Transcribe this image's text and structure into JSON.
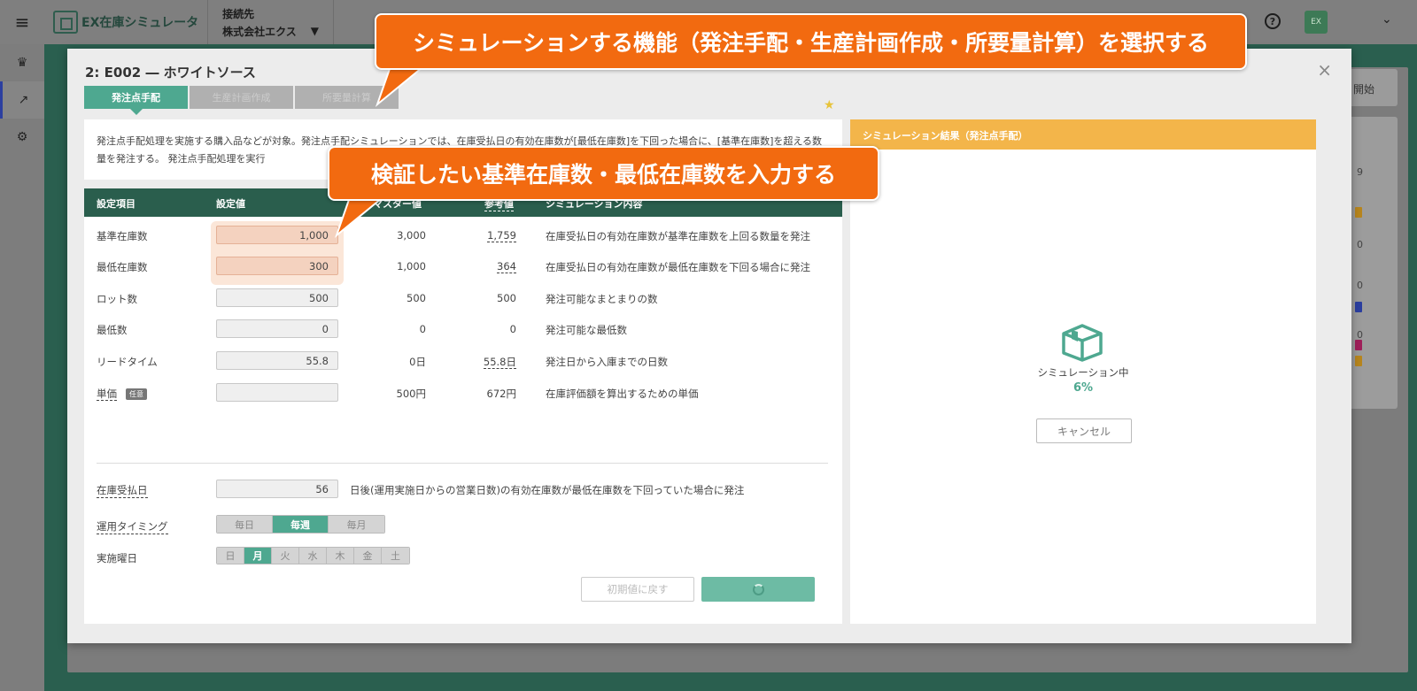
{
  "app": {
    "logo_text": "EX在庫シミュレータ",
    "connection_label": "接続先",
    "connection_value": "株式会社エクス",
    "user_initials": "EX",
    "bg_card_label": "開始",
    "bg_numbers": [
      "9",
      "0",
      "0",
      "0"
    ]
  },
  "modal": {
    "title": "2: E002 ― ホワイトソース",
    "close_label": "×",
    "tabs": [
      {
        "label": "発注点手配",
        "active": true
      },
      {
        "label": "生産計画作成",
        "active": false
      },
      {
        "label": "所要量計算",
        "active": false
      }
    ],
    "description": "発注点手配処理を実施する購入品などが対象。発注点手配シミュレーションでは、在庫受払日の有効在庫数が[最低在庫数]を下回った場合に、[基準在庫数]を超える数量を発注する。 発注点手配処理を実行"
  },
  "settings": {
    "headers": {
      "item": "設定項目",
      "value": "設定値",
      "master": "マスター値",
      "reference": "参考値",
      "simulation": "シミュレーション内容"
    },
    "rows": [
      {
        "label": "基準在庫数",
        "value": "1,000",
        "master": "3,000",
        "reference": "1,759",
        "sim": "在庫受払日の有効在庫数が基準在庫数を上回る数量を発注"
      },
      {
        "label": "最低在庫数",
        "value": "300",
        "master": "1,000",
        "reference": "364",
        "sim": "在庫受払日の有効在庫数が最低在庫数を下回る場合に発注"
      },
      {
        "label": "ロット数",
        "value": "500",
        "master": "500",
        "reference": "500",
        "sim": "発注可能なまとまりの数"
      },
      {
        "label": "最低数",
        "value": "0",
        "master": "0",
        "reference": "0",
        "sim": "発注可能な最低数"
      },
      {
        "label": "リードタイム",
        "value": "55.8",
        "master": "0日",
        "reference": "55.8日",
        "sim": "発注日から入庫までの日数"
      },
      {
        "label": "単価",
        "value": "",
        "master": "500円",
        "reference": "672円",
        "sim": "在庫評価額を算出するための単価",
        "badge": "任意"
      }
    ],
    "inventory_day": {
      "label": "在庫受払日",
      "value": "56",
      "note": "日後(運用実施日からの営業日数)の有効在庫数が最低在庫数を下回っていた場合に発注"
    },
    "timing": {
      "label": "運用タイミング",
      "options": [
        "毎日",
        "毎週",
        "毎月"
      ],
      "selected": "毎週"
    },
    "weekday": {
      "label": "実施曜日",
      "options": [
        "日",
        "月",
        "火",
        "水",
        "木",
        "金",
        "土"
      ],
      "selected": "月"
    },
    "reset_label": "初期値に戻す"
  },
  "result": {
    "title": "シミュレーション結果（発注点手配）",
    "status": "シミュレーション中",
    "progress": "6%",
    "cancel_label": "キャンセル"
  },
  "callouts": {
    "top": "シミュレーションする機能（発注手配・生産計画作成・所要量計算）を選択する",
    "middle": "検証したい基準在庫数・最低在庫数を入力する"
  },
  "colors": {
    "accent": "#4ea890",
    "header_dark": "#2a5e4d",
    "result_header": "#f3b54a",
    "callout": "#f26a10",
    "highlight": "#f4d2bf"
  }
}
